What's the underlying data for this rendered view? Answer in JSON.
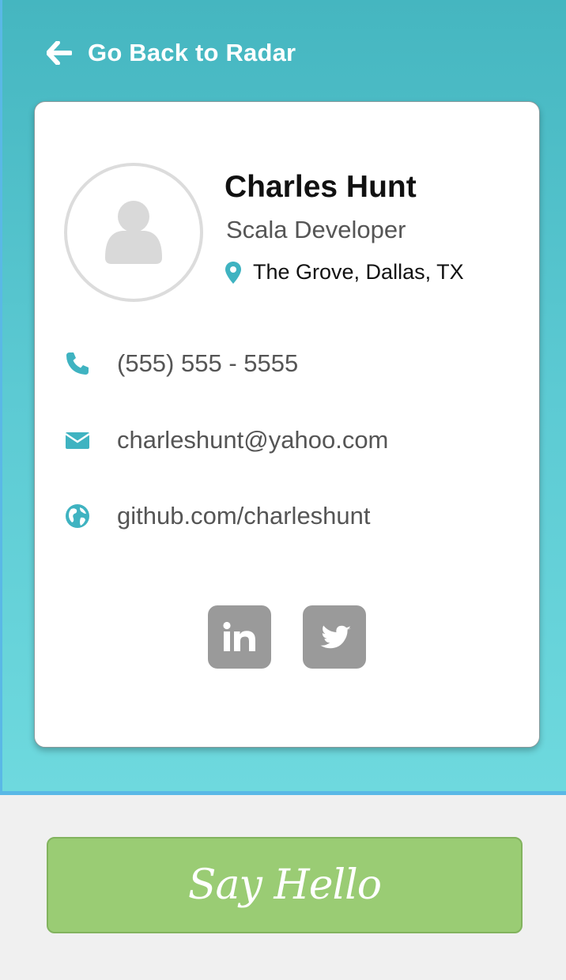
{
  "nav": {
    "back_label": "Go Back to Radar",
    "back_icon": "arrow-left-icon"
  },
  "profile": {
    "name": "Charles Hunt",
    "role": "Scala Developer",
    "location": "The Grove, Dallas, TX",
    "location_icon": "map-pin-icon",
    "avatar_icon": "user-placeholder-icon"
  },
  "contact": {
    "phone": "(555) 555 - 5555",
    "phone_icon": "phone-icon",
    "email": "charleshunt@yahoo.com",
    "email_icon": "envelope-icon",
    "website": "github.com/charleshunt",
    "website_icon": "globe-icon"
  },
  "social": [
    {
      "name": "linkedin",
      "icon": "linkedin-icon"
    },
    {
      "name": "twitter",
      "icon": "twitter-icon"
    }
  ],
  "action": {
    "say_hello_label": "Say Hello"
  },
  "colors": {
    "header_gradient_top": "#45b6c0",
    "header_gradient_bottom": "#6ed9de",
    "accent": "#3fb3c1",
    "button_green": "#9acc74",
    "social_gray": "#9a9a9a"
  }
}
